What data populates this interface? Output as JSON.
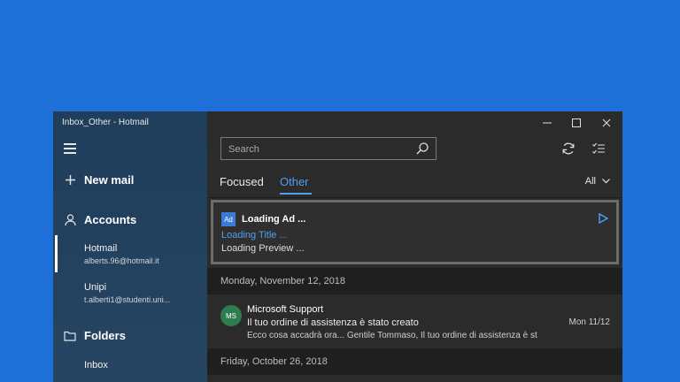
{
  "window": {
    "title": "Inbox_Other - Hotmail"
  },
  "sidebar": {
    "new_mail": "New mail",
    "accounts_label": "Accounts",
    "accounts": [
      {
        "name": "Hotmail",
        "email": "alberts.96@hotmail.it"
      },
      {
        "name": "Unipi",
        "email": "t.alberti1@studenti.uni..."
      }
    ],
    "folders_label": "Folders",
    "folders": [
      {
        "label": "Inbox"
      }
    ]
  },
  "main": {
    "search": {
      "placeholder": "Search"
    },
    "tabs": [
      {
        "label": "Focused"
      },
      {
        "label": "Other"
      }
    ],
    "active_tab": "Other",
    "filter": "All",
    "ad": {
      "badge": "Ad",
      "sender": "Loading Ad ...",
      "title": "Loading Title ...",
      "preview": "Loading Preview ..."
    },
    "groups": [
      {
        "date": "Monday, November 12, 2018",
        "messages": [
          {
            "avatar": "MS",
            "from": "Microsoft Support",
            "subject": "Il tuo ordine di assistenza è stato creato",
            "date": "Mon 11/12",
            "preview": "Ecco cosa accadrà ora... Gentile Tommaso, Il tuo ordine di assistenza è st"
          }
        ]
      },
      {
        "date": "Friday, October 26, 2018",
        "messages": []
      }
    ]
  },
  "colors": {
    "desktop": "#1f6fd8",
    "accent": "#4ea0f0",
    "avatar": "#2e7d4f"
  }
}
